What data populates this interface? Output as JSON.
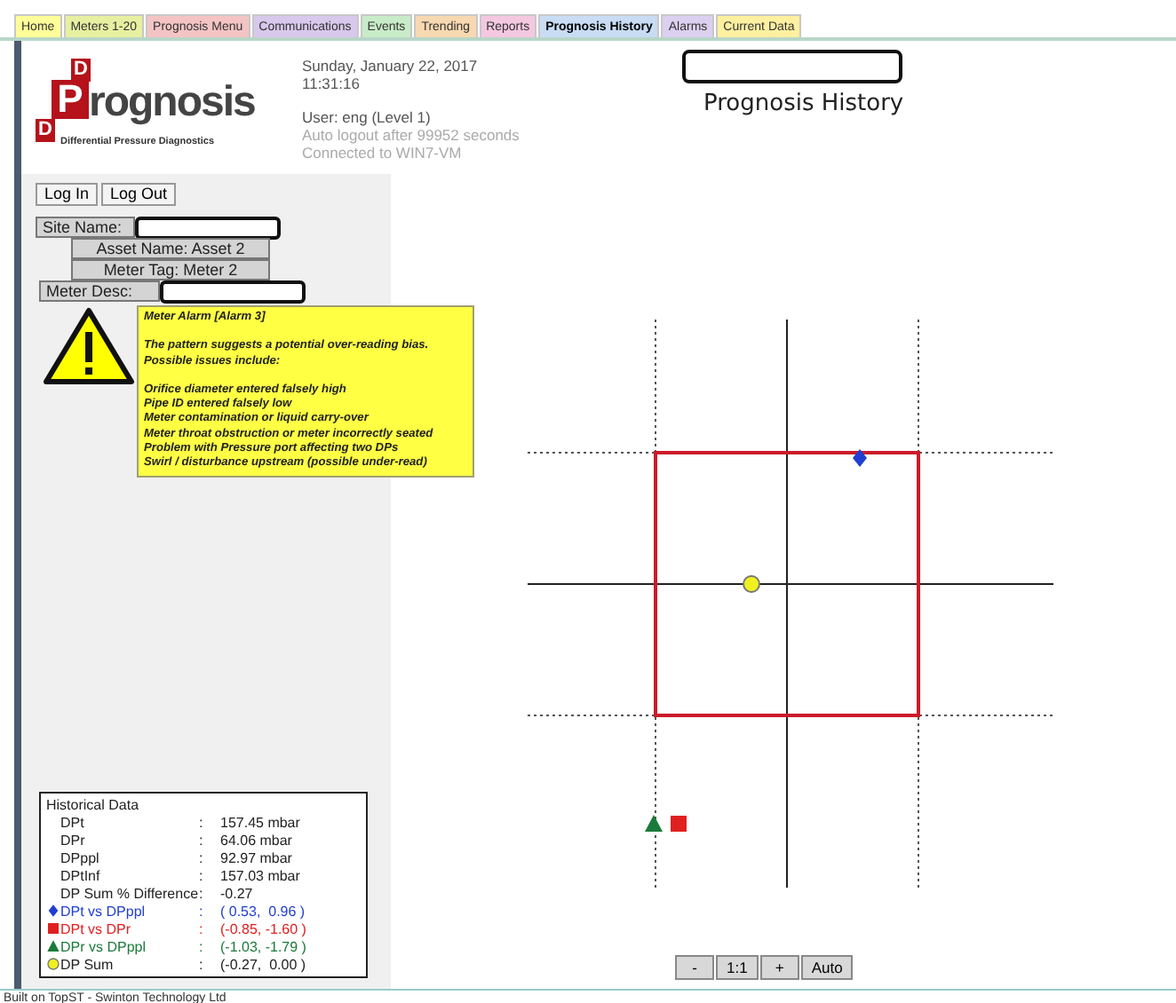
{
  "tabs": [
    {
      "label": "Home",
      "color": "#ffff99",
      "selected": false
    },
    {
      "label": "Meters 1-20",
      "color": "#e6f0a0",
      "selected": false
    },
    {
      "label": "Prognosis Menu",
      "color": "#f4c4c4",
      "selected": false
    },
    {
      "label": "Communications",
      "color": "#d8c8ec",
      "selected": false
    },
    {
      "label": "Events",
      "color": "#c8ecc8",
      "selected": false
    },
    {
      "label": "Trending",
      "color": "#f8d8b0",
      "selected": false
    },
    {
      "label": "Reports",
      "color": "#f4c8e0",
      "selected": false
    },
    {
      "label": "Prognosis History",
      "color": "#c8dcf4",
      "selected": true
    },
    {
      "label": "Alarms",
      "color": "#dcd0f0",
      "selected": false
    },
    {
      "label": "Current Data",
      "color": "#fff0a0",
      "selected": false
    }
  ],
  "header": {
    "logo": {
      "letters": [
        "D",
        "P",
        "D"
      ],
      "wordmark": "rognosis",
      "tagline": "Differential Pressure Diagnostics"
    },
    "date": "Sunday, January 22, 2017",
    "time": "11:31:16",
    "user": "User: eng (Level 1)",
    "logout_note": "Auto logout after 99952 seconds",
    "connection": "Connected to WIN7-VM",
    "title_redacted": true,
    "page_title": "Prognosis History"
  },
  "auth_links": [
    "Log In",
    "Log Out"
  ],
  "meter_info": [
    {
      "label": "Site Name:",
      "kind": "redacted"
    },
    {
      "label": "Asset Name:",
      "value": "Asset 2",
      "kind": "text"
    },
    {
      "label": "Meter Tag:",
      "value": "Meter 2",
      "kind": "text"
    },
    {
      "label": "Meter Desc:",
      "kind": "redacted"
    }
  ],
  "alarm": {
    "title": "Meter Alarm [Alarm 3]",
    "summary": "The pattern suggests a potential over-reading bias.",
    "intro": "Possible issues include:",
    "issues": [
      "Orifice diameter entered falsely high",
      "Pipe ID entered falsely low",
      "Meter contamination or liquid carry-over",
      "Meter throat obstruction or meter incorrectly seated",
      "Problem with Pressure port affecting two DPs",
      "Swirl / disturbance upstream (possible under-read)"
    ]
  },
  "historical": {
    "title": "Historical Data",
    "rows": [
      {
        "label": "DPt",
        "separator": ":",
        "value": "157.45 mbar"
      },
      {
        "label": "DPr",
        "separator": ":",
        "value": "64.06 mbar"
      },
      {
        "label": "DPppl",
        "separator": ":",
        "value": "92.97 mbar"
      },
      {
        "label": "DPtInf",
        "separator": ":",
        "value": "157.03 mbar"
      },
      {
        "label": "DP Sum % Difference",
        "separator": ":",
        "value": "-0.27"
      }
    ],
    "series": [
      {
        "label": "DPt vs DPppl",
        "separator": ":",
        "value": "( 0.53,  0.96 )",
        "kind": "diamond",
        "color": "#1f3fd0"
      },
      {
        "label": "DPt vs DPr",
        "separator": ":",
        "value": "(-0.85, -1.60 )",
        "kind": "square",
        "color": "#e02020"
      },
      {
        "label": "DPr vs DPppl",
        "separator": ":",
        "value": "(-1.03, -1.79 )",
        "kind": "triangle",
        "color": "#1a7a3a"
      },
      {
        "label": "DP Sum",
        "separator": ":",
        "value": "(-0.27,  0.00 )",
        "kind": "circle",
        "color": "#f0f020"
      }
    ]
  },
  "zoom_controls": [
    "-",
    "1:1",
    "+",
    "Auto"
  ],
  "status_bar": "Built on TopST - Swinton Technology Ltd"
}
